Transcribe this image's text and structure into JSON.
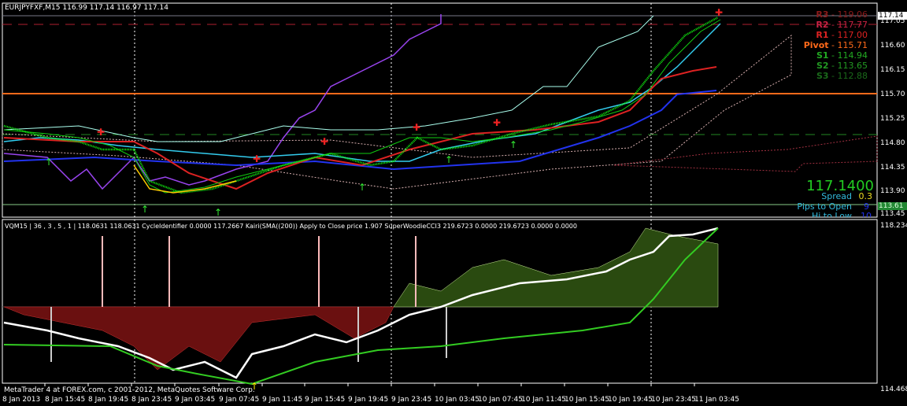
{
  "main_chart": {
    "header": "EURJPYFXF,M15  116.99 117.14 116.97 117.14",
    "pivots": [
      {
        "label": "R3",
        "value": "119.06",
        "color": "#8b1a1a"
      },
      {
        "label": "R2",
        "value": "117.77",
        "color": "#cc2244"
      },
      {
        "label": "R1",
        "value": "117.00",
        "color": "#dd2222"
      },
      {
        "label": "Pivot",
        "value": "115.71",
        "color": "#ff6a1a"
      },
      {
        "label": "S1",
        "value": "114.94",
        "color": "#22aa22"
      },
      {
        "label": "S2",
        "value": "113.65",
        "color": "#229922"
      },
      {
        "label": "S3",
        "value": "112.88",
        "color": "#1a6a1a"
      }
    ],
    "price": "117.1400",
    "spread_label": "Spread",
    "spread_value": "0.3",
    "pips_label": "Pips to Open",
    "pips_value": "9",
    "hilo_label": "Hi to Low",
    "hilo_value": "10",
    "price_axis": [
      "117.05",
      "116.60",
      "116.15",
      "115.70",
      "115.25",
      "114.80",
      "114.35",
      "113.90",
      "113.45"
    ],
    "current_price_tag": "117.14",
    "green_price_tag": "113.61"
  },
  "indicator_pane": {
    "header": "VQM15 | 36 , 3 , 5 , 1 | 118.0631 118.0631  CycleIdentifier 0.0000 117.2667  Kairi(SMA((200)) Apply to Close price 1.907  SuperWoodieCCI3 219.6723 0.0000 219.6723 0.0000 0.0000",
    "axis_top": "118.234",
    "axis_bottom": "114.468",
    "copyright": "MetaTrader 4 at FOREX.com, c 2001-2012, MetaQuotes Software Corp."
  },
  "time_axis": [
    "8 Jan 2013",
    "8 Jan 15:45",
    "8 Jan 19:45",
    "8 Jan 23:45",
    "9 Jan 03:45",
    "9 Jan 07:45",
    "9 Jan 11:45",
    "9 Jan 15:45",
    "9 Jan 19:45",
    "9 Jan 23:45",
    "10 Jan 03:45",
    "10 Jan 07:45",
    "10 Jan 11:45",
    "10 Jan 15:45",
    "10 Jan 19:45",
    "10 Jan 23:45",
    "11 Jan 03:45"
  ]
}
